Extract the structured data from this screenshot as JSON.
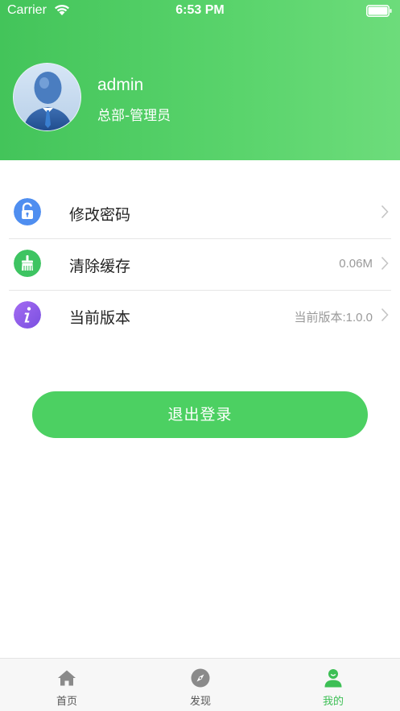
{
  "status_bar": {
    "carrier": "Carrier",
    "time": "6:53 PM"
  },
  "profile": {
    "username": "admin",
    "role": "总部-管理员"
  },
  "menu": {
    "items": [
      {
        "label": "修改密码",
        "value": "",
        "icon": "lock-icon",
        "color": "#4f8ef0"
      },
      {
        "label": "清除缓存",
        "value": "0.06M",
        "icon": "broom-icon",
        "color": "#3ec462"
      },
      {
        "label": "当前版本",
        "value": "当前版本:1.0.0",
        "icon": "info-icon",
        "color": "#8e5ce8"
      }
    ]
  },
  "logout": {
    "label": "退出登录"
  },
  "tab_bar": {
    "tabs": [
      {
        "label": "首页",
        "icon": "home-icon",
        "active": false
      },
      {
        "label": "发现",
        "icon": "compass-icon",
        "active": false
      },
      {
        "label": "我的",
        "icon": "user-icon",
        "active": true
      }
    ]
  },
  "colors": {
    "accent": "#4cd062",
    "header_start": "#43c45a",
    "header_end": "#6ddc7b",
    "tab_active": "#3dbf55",
    "tab_inactive": "#888888"
  }
}
